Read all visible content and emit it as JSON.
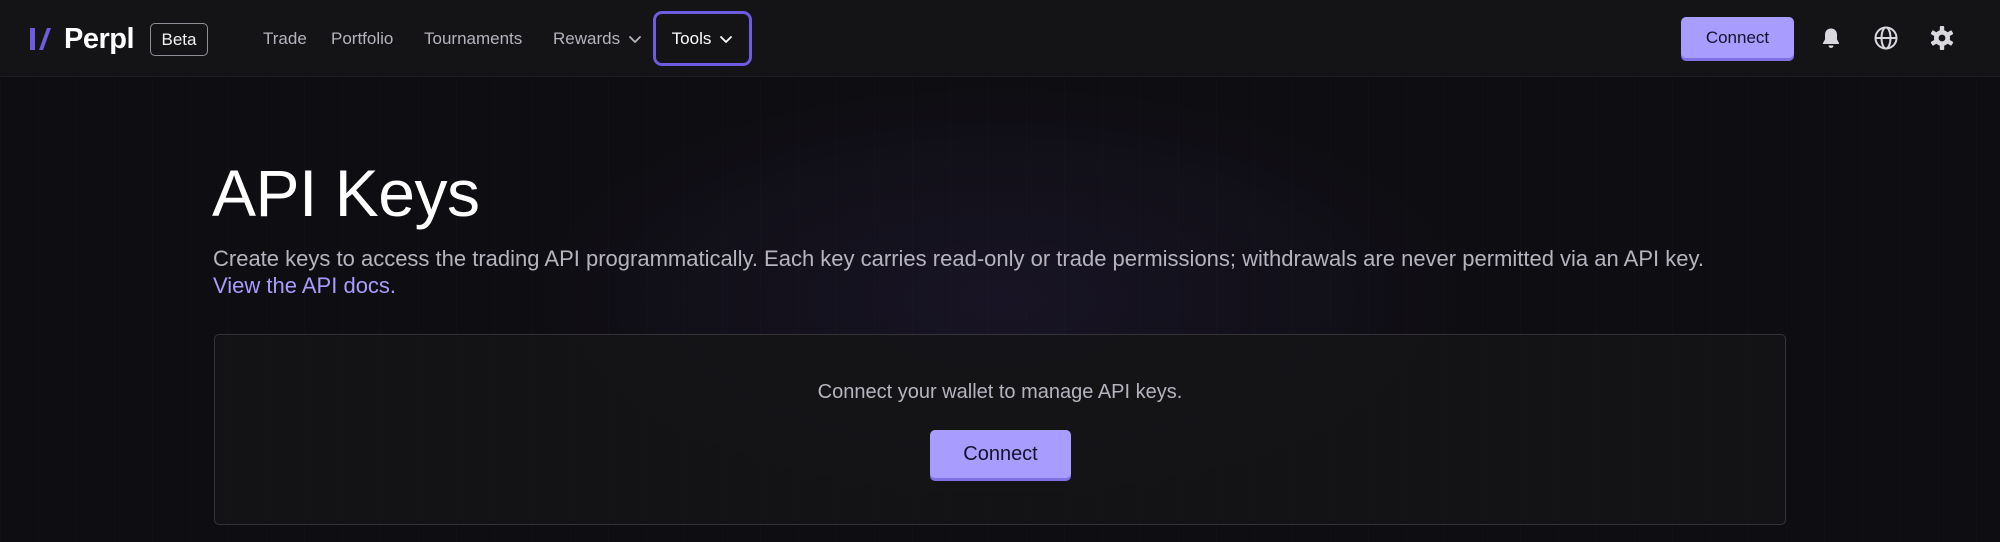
{
  "brand": {
    "name": "Perpl",
    "badge": "Beta",
    "accent": "#a89cff",
    "logo_color": "#6d5be0"
  },
  "nav": {
    "items": [
      {
        "label": "Trade"
      },
      {
        "label": "Portfolio"
      },
      {
        "label": "Tournaments"
      },
      {
        "label": "Rewards",
        "icon": "chevron-down-icon"
      },
      {
        "label": "Tools",
        "icon": "chevron-down-icon",
        "active": true
      }
    ]
  },
  "header_actions": {
    "connect_label": "Connect",
    "icons": [
      "bell-icon",
      "globe-icon",
      "gear-icon"
    ]
  },
  "main": {
    "title": "API Keys",
    "description": "Create keys to access the trading API programmatically. Each key carries read-only or trade permissions; withdrawals are never permitted via an API key.",
    "docs_link": "View the API docs.",
    "panel": {
      "message": "Connect your wallet to manage API keys.",
      "connect_label": "Connect"
    }
  }
}
